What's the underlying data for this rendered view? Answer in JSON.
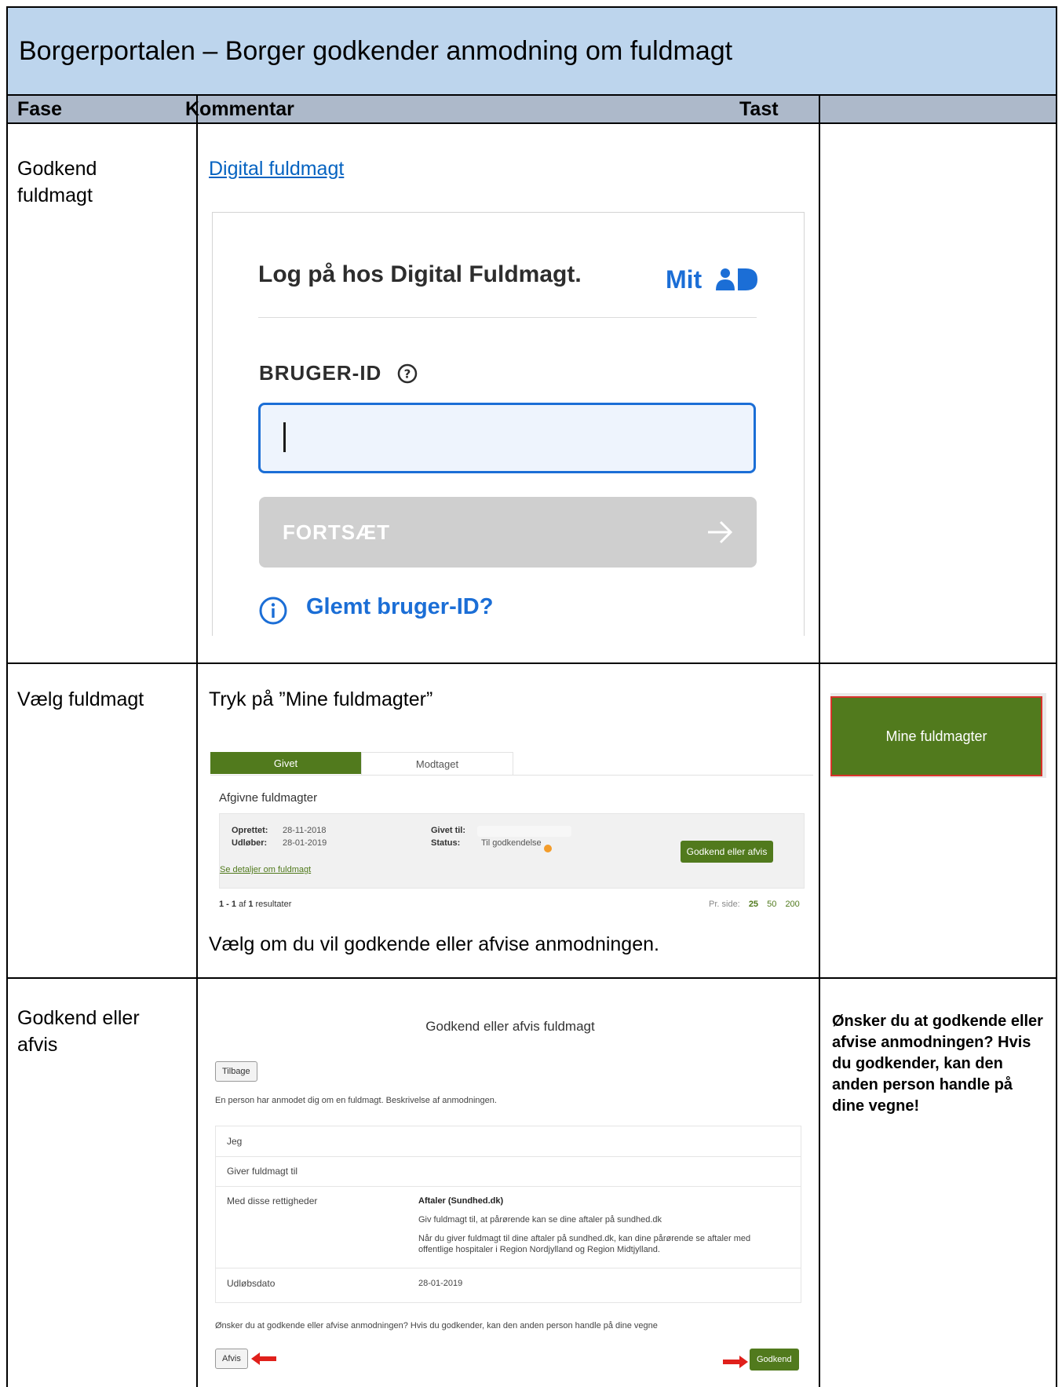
{
  "document": {
    "title": "Borgerportalen – Borger godkender anmodning om fuldmagt",
    "headers": {
      "fase": "Fase",
      "kommentar": "Kommentar",
      "tast": "Tast"
    }
  },
  "rows": [
    {
      "fase": "Godkend fuldmagt",
      "link": "Digital fuldmagt",
      "login": {
        "title": "Log på hos Digital Fuldmagt.",
        "logo_text": "Mit",
        "user_id_label": "BRUGER-ID",
        "input_value": "",
        "continue_label": "FORTSÆT",
        "forgot_label": "Glemt bruger-ID?"
      }
    },
    {
      "fase": "Vælg fuldmagt",
      "instruction": "Tryk på ”Mine fuldmagter”",
      "tabs": [
        "Givet",
        "Modtaget"
      ],
      "section_title": "Afgivne fuldmagter",
      "record": {
        "oprettet_label": "Oprettet:",
        "oprettet": "28-11-2018",
        "udloeber_label": "Udløber:",
        "udloeber": "28-01-2019",
        "givet_til_label": "Givet til:",
        "status_label": "Status:",
        "status": "Til godkendelse",
        "action": "Godkend eller afvis",
        "details_link": "Se detaljer om fuldmagt"
      },
      "results": {
        "range": "1 - 1",
        "of": "af",
        "total": "1",
        "suffix": "resultater"
      },
      "per_page": {
        "label": "Pr. side:",
        "options": [
          "25",
          "50",
          "200"
        ],
        "selected": "25"
      },
      "note": "Vælg om du vil godkende eller afvise anmodningen.",
      "tast_button": "Mine fuldmagter"
    },
    {
      "fase": "Godkend eller afvis",
      "modal_title": "Godkend eller afvis fuldmagt",
      "back": "Tilbage",
      "description": "En person har anmodet dig om en fuldmagt. Beskrivelse af anmodningen.",
      "table": {
        "jeg": "Jeg",
        "giver": "Giver fuldmagt til",
        "rettigheder_label": "Med disse rettigheder",
        "rettighed_title": "Aftaler (Sundhed.dk)",
        "rettighed_line1": "Giv fuldmagt til, at pårørende kan se dine aftaler på sundhed.dk",
        "rettighed_line2": "Når du giver fuldmagt til dine aftaler på sundhed.dk, kan dine pårørende se aftaler med",
        "rettighed_line3": "offentlige hospitaler i Region Nordjylland og Region Midtjylland.",
        "udloeb_label": "Udløbsdato",
        "udloeb": "28-01-2019"
      },
      "question": "Ønsker du at godkende eller afvise anmodningen? Hvis du godkender, kan den anden person handle på dine vegne",
      "afvis": "Afvis",
      "godkend": "Godkend",
      "tast_text": "Ønsker du at godkende eller afvise anmodningen? Hvis du godkender, kan den anden person handle på dine vegne!"
    }
  ],
  "colors": {
    "title_bg": "#bdd5ed",
    "header_bg": "#adb9ca",
    "green": "#517a1d",
    "mitid_blue": "#1b6ed6"
  },
  "icons": [
    "mitid-person-icon",
    "help-icon",
    "arrow-right-icon",
    "info-icon",
    "red-arrow-icon"
  ]
}
